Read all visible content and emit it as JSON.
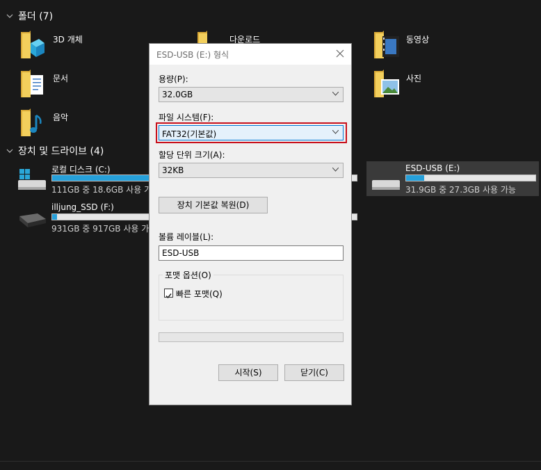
{
  "sections": {
    "folders_label": "폴더 (7)",
    "drives_label": "장치 및 드라이브 (4)"
  },
  "folders": [
    {
      "label": "3D 개체",
      "icon": "3d-objects-folder-icon"
    },
    {
      "label": "다운로드",
      "icon": "downloads-folder-icon"
    },
    {
      "label": "동영상",
      "icon": "videos-folder-icon"
    },
    {
      "label": "문서",
      "icon": "documents-folder-icon"
    },
    {
      "label": "사진",
      "icon": "pictures-folder-icon"
    },
    {
      "label": "음악",
      "icon": "music-folder-icon"
    }
  ],
  "drives": [
    {
      "name": "로컬 디스크 (C:)",
      "free": "111GB 중 18.6GB 사용 가능",
      "used_fraction": 0.83
    },
    {
      "name": "illjung_SSD (F:)",
      "free": "931GB 중 917GB 사용 가능",
      "used_fraction": 0.015
    },
    {
      "name": "ESD-USB (E:)",
      "free": "31.9GB 중 27.3GB 사용 가능",
      "used_fraction": 0.14
    }
  ],
  "dialog": {
    "title": "ESD-USB (E:) 형식",
    "capacity_label": "용량(P):",
    "capacity_value": "32.0GB",
    "filesystem_label": "파일 시스템(F):",
    "filesystem_value": "FAT32(기본값)",
    "alloc_label": "할당 단위 크기(A):",
    "alloc_value": "32KB",
    "restore_button": "장치 기본값 복원(D)",
    "volume_label": "볼륨 레이블(L):",
    "volume_value": "ESD-USB",
    "format_options_label": "포맷 옵션(O)",
    "quick_format_label": "빠른 포맷(Q)",
    "quick_format_checked": true,
    "progress": 0,
    "start_button": "시작(S)",
    "close_button": "닫기(C)"
  },
  "colors": {
    "bar_fill": "#26a0da",
    "highlight": "#c8101c"
  }
}
